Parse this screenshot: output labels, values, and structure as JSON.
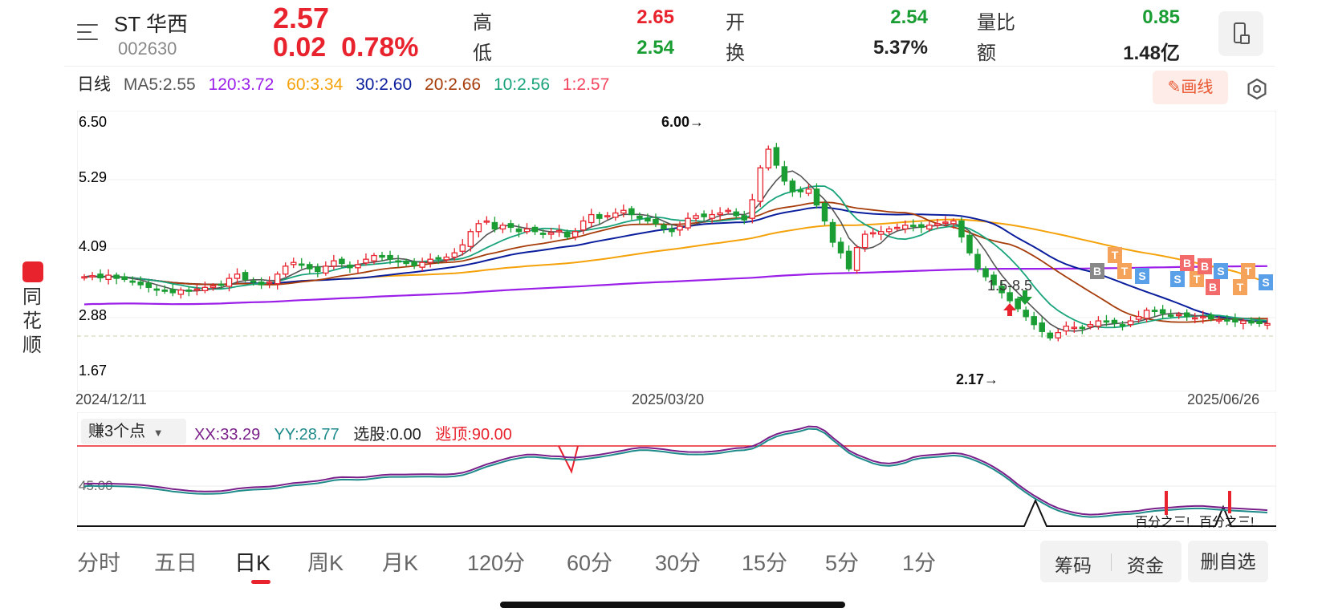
{
  "header": {
    "name": "ST 华西",
    "code": "002630",
    "price": "2.57",
    "change": "0.02",
    "change_pct": "0.78%",
    "high_label": "高",
    "high": "2.65",
    "low_label": "低",
    "low": "2.54",
    "open_label": "开",
    "open": "2.54",
    "turnover_label": "换",
    "turnover": "5.37%",
    "vol_ratio_label": "量比",
    "vol_ratio": "0.85",
    "amount_label": "额",
    "amount": "1.48亿"
  },
  "ma_row": {
    "period": "日线",
    "ma5": "MA5:2.55",
    "ma120": "120:3.72",
    "ma60": "60:3.34",
    "ma30": "30:2.60",
    "ma20": "20:2.66",
    "ma10": "10:2.56",
    "ma1": "1:2.57",
    "draw_label": "画线"
  },
  "brand": {
    "chars": [
      "同",
      "花",
      "顺"
    ]
  },
  "colors": {
    "up": "#e8232e",
    "down": "#1a9e34",
    "ma5": "#555555",
    "ma120": "#9b1fe8",
    "ma60": "#f5a20a",
    "ma30": "#0a1d9c",
    "ma20": "#a63c0a",
    "ma10": "#18a37b",
    "ma1": "#f2455f",
    "xx": "#7a1f8a",
    "yy": "#1e8a8a"
  },
  "chart_data": {
    "type": "candlestick",
    "y_ticks": [
      "6.50",
      "5.29",
      "4.09",
      "2.88",
      "1.67"
    ],
    "x_ticks": [
      "2024/12/11",
      "2025/03/20",
      "2025/06/26"
    ],
    "annotations": {
      "high_mark": "6.00→",
      "low_mark": "2.17→",
      "range_text": "1.5-8.5"
    },
    "ylim": [
      1.67,
      6.5
    ],
    "closes": [
      3.45,
      3.47,
      3.43,
      3.48,
      3.42,
      3.4,
      3.35,
      3.3,
      3.25,
      3.2,
      3.18,
      3.15,
      3.2,
      3.18,
      3.22,
      3.25,
      3.28,
      3.3,
      3.42,
      3.5,
      3.4,
      3.35,
      3.3,
      3.35,
      3.5,
      3.65,
      3.72,
      3.68,
      3.6,
      3.55,
      3.65,
      3.75,
      3.7,
      3.62,
      3.68,
      3.78,
      3.85,
      3.82,
      3.78,
      3.74,
      3.7,
      3.66,
      3.72,
      3.78,
      3.8,
      3.82,
      3.9,
      4.05,
      4.3,
      4.45,
      4.5,
      4.35,
      4.42,
      4.38,
      4.3,
      4.35,
      4.3,
      4.25,
      4.28,
      4.32,
      4.2,
      4.3,
      4.5,
      4.62,
      4.55,
      4.6,
      4.65,
      4.7,
      4.62,
      4.55,
      4.5,
      4.45,
      4.35,
      4.3,
      4.4,
      4.55,
      4.6,
      4.58,
      4.62,
      4.65,
      4.7,
      4.6,
      4.52,
      4.9,
      5.5,
      5.85,
      5.55,
      5.25,
      5.05,
      5.05,
      5.1,
      4.8,
      4.5,
      4.1,
      3.9,
      3.6,
      4.0,
      4.25,
      4.28,
      4.3,
      4.35,
      4.38,
      4.42,
      4.4,
      4.38,
      4.42,
      4.45,
      4.48,
      4.5,
      4.2,
      3.9,
      3.6,
      3.45,
      3.3,
      3.15,
      3.0,
      2.85,
      2.7,
      2.55,
      2.42,
      2.3,
      2.4,
      2.52,
      2.5,
      2.48,
      2.55,
      2.62,
      2.6,
      2.58,
      2.55,
      2.62,
      2.7,
      2.82,
      2.8,
      2.76,
      2.72,
      2.74,
      2.7,
      2.68,
      2.7,
      2.66,
      2.64,
      2.62,
      2.6,
      2.62,
      2.58,
      2.57,
      2.57
    ]
  },
  "indicator": {
    "name": "赚3个点",
    "xx": "XX:33.29",
    "yy": "YY:28.77",
    "pick": "选股:0.00",
    "top_escape": "逃顶:90.00",
    "tick": "45.00",
    "note1": "百分之三!",
    "note2": "百分之三!"
  },
  "tabs": [
    "分时",
    "五日",
    "日K",
    "周K",
    "月K",
    "120分",
    "60分",
    "30分",
    "15分",
    "5分",
    "1分"
  ],
  "active_tab": "日K",
  "buttons": {
    "chips": "筹码",
    "funds": "资金",
    "delete": "删自选"
  }
}
